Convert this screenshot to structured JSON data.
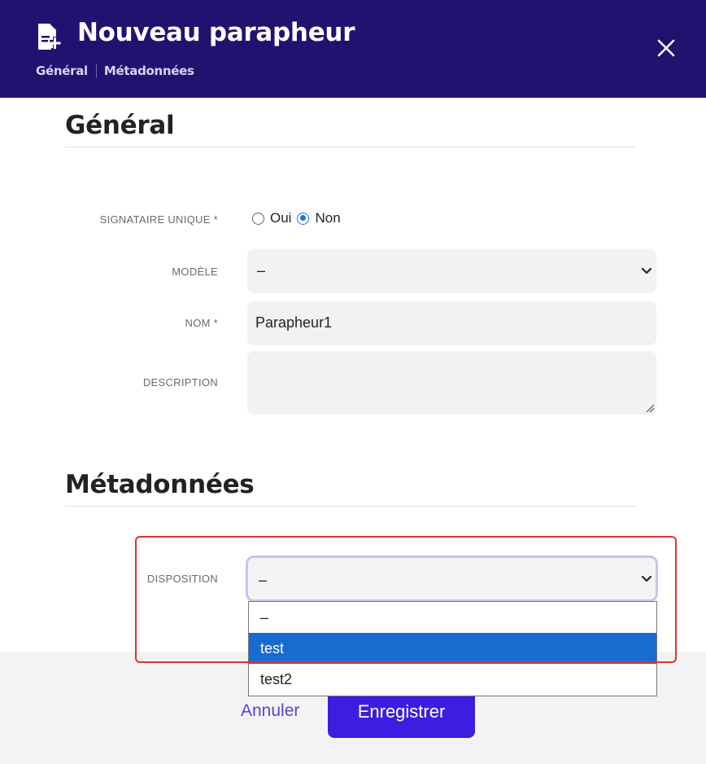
{
  "header": {
    "title": "Nouveau parapheur",
    "icon": "file-plus-icon",
    "close_icon": "close-icon",
    "nav": [
      "Général",
      "Métadonnées"
    ],
    "background": "#221270"
  },
  "general": {
    "title": "Général",
    "signataire": {
      "label": "SIGNATAIRE UNIQUE *",
      "options": [
        "Oui",
        "Non"
      ],
      "selected": "Non"
    },
    "modele": {
      "label": "MODÈLE",
      "value": "–"
    },
    "nom": {
      "label": "NOM *",
      "value": "Parapheur1"
    },
    "description": {
      "label": "DESCRIPTION",
      "value": ""
    }
  },
  "metadonnees": {
    "title": "Métadonnées",
    "disposition": {
      "label": "DISPOSITION",
      "value": "–",
      "options": [
        "–",
        "test",
        "test2"
      ],
      "highlighted": "test"
    }
  },
  "footer": {
    "cancel_label": "Annuler",
    "save_label": "Enregistrer",
    "accent": "#3c1ee0"
  }
}
